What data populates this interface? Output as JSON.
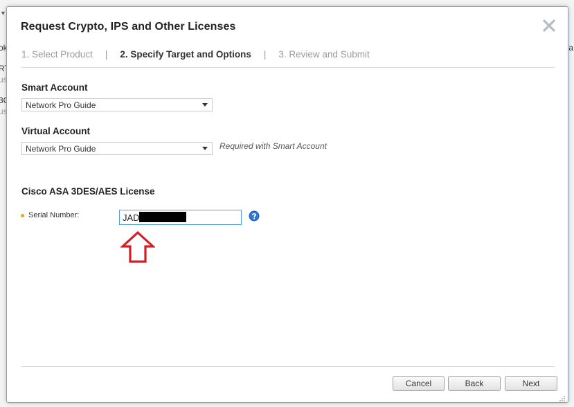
{
  "background": {
    "fragments_left": [
      "ok",
      "RT",
      "us",
      "3C",
      "us"
    ],
    "fragment_right": "/a"
  },
  "dialog": {
    "title": "Request Crypto, IPS and Other Licenses",
    "close_icon": "close-x-icon",
    "steps": [
      {
        "label": "1. Select Product",
        "state": "done"
      },
      {
        "label": "2. Specify Target and Options",
        "state": "active"
      },
      {
        "label": "3. Review and Submit",
        "state": "pending"
      }
    ],
    "step_separator": "|",
    "smart_account": {
      "label": "Smart Account",
      "selected": "Network Pro Guide"
    },
    "virtual_account": {
      "label": "Virtual Account",
      "selected": "Network Pro Guide",
      "hint": "Required with Smart Account"
    },
    "license_section": {
      "title": "Cisco ASA 3DES/AES License",
      "serial_label": "Serial Number:",
      "serial_value": "JAD",
      "help_icon": "question-circle-icon"
    },
    "buttons": {
      "cancel": "Cancel",
      "back": "Back",
      "next": "Next"
    },
    "colors": {
      "accent_border": "#4aa3d8",
      "required_dot": "#e8a317",
      "annotation_arrow": "#d21f26",
      "help_icon": "#1a5fb4"
    }
  }
}
